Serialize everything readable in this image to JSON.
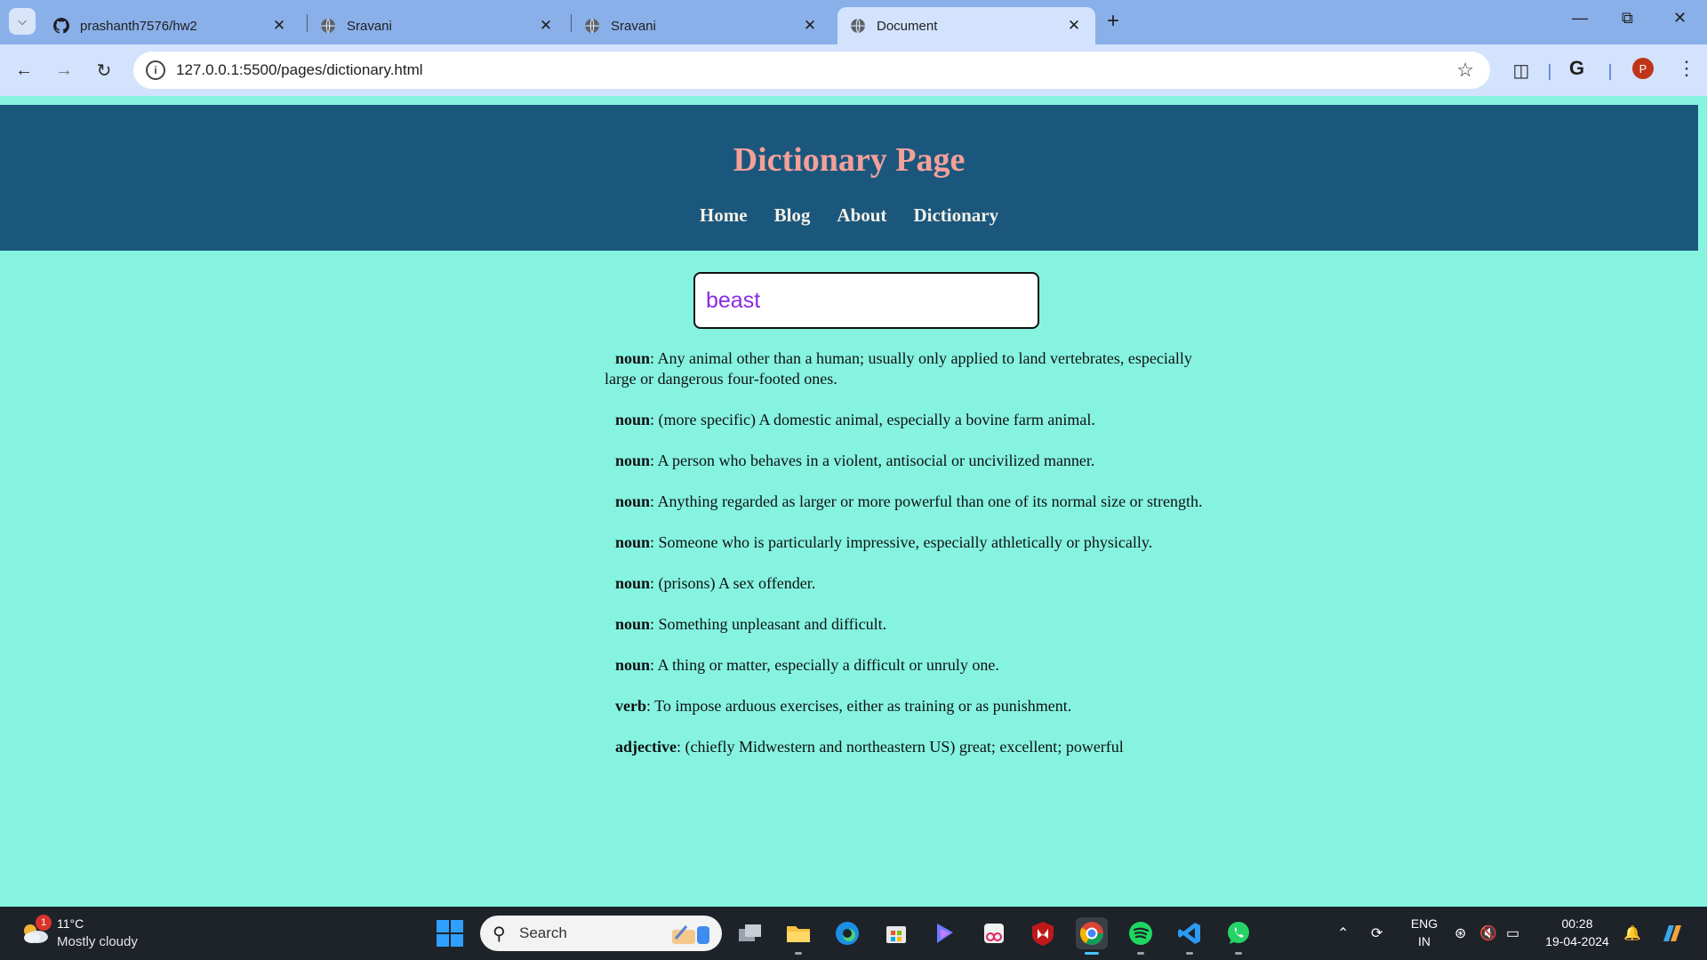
{
  "browser": {
    "tabs": [
      {
        "title": "prashanth7576/hw2",
        "favicon": "github-icon"
      },
      {
        "title": "Sravani",
        "favicon": "globe-icon"
      },
      {
        "title": "Sravani",
        "favicon": "globe-icon"
      },
      {
        "title": "Document",
        "favicon": "globe-icon",
        "active": true
      }
    ],
    "url": "127.0.0.1:5500/pages/dictionary.html",
    "profile_initial": "P"
  },
  "site": {
    "title": "Dictionary Page",
    "nav": [
      "Home",
      "Blog",
      "About",
      "Dictionary"
    ]
  },
  "search": {
    "value": "beast"
  },
  "definitions": [
    {
      "pos": "noun",
      "text": ": Any animal other than a human; usually only applied to land vertebrates, especially large or dangerous four-footed ones."
    },
    {
      "pos": "noun",
      "text": ": (more specific) A domestic animal, especially a bovine farm animal."
    },
    {
      "pos": "noun",
      "text": ": A person who behaves in a violent, antisocial or uncivilized manner."
    },
    {
      "pos": "noun",
      "text": ": Anything regarded as larger or more powerful than one of its normal size or strength."
    },
    {
      "pos": "noun",
      "text": ": Someone who is particularly impressive, especially athletically or physically."
    },
    {
      "pos": "noun",
      "text": ": (prisons) A sex offender."
    },
    {
      "pos": "noun",
      "text": ": Something unpleasant and difficult."
    },
    {
      "pos": "noun",
      "text": ": A thing or matter, especially a difficult or unruly one."
    },
    {
      "pos": "verb",
      "text": ": To impose arduous exercises, either as training or as punishment."
    },
    {
      "pos": "adjective",
      "text": ": (chiefly Midwestern and northeastern US) great; excellent; powerful"
    }
  ],
  "taskbar": {
    "weather_temp": "11°C",
    "weather_desc": "Mostly cloudy",
    "weather_badge": "1",
    "search_label": "Search",
    "lang_top": "ENG",
    "lang_bottom": "IN",
    "time": "00:28",
    "date": "19-04-2024"
  },
  "colors": {
    "page_bg": "#85f3e0",
    "header_bg": "#1b577d",
    "title_color": "#f4a09a",
    "search_text": "#8a2be2"
  }
}
